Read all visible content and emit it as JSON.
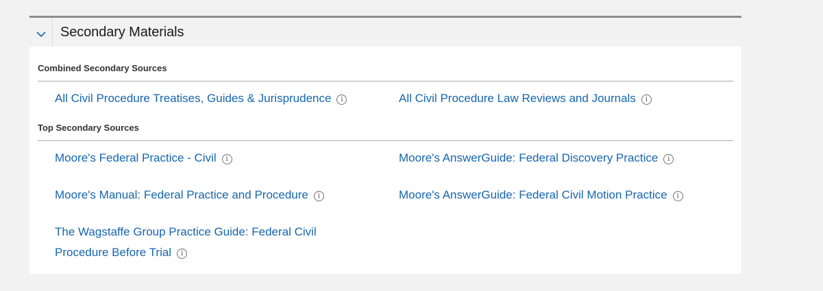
{
  "section": {
    "title": "Secondary Materials"
  },
  "groups": [
    {
      "label": "Combined Secondary Sources",
      "links": [
        {
          "text": "All Civil Procedure Treatises, Guides & Jurisprudence"
        },
        {
          "text": "All Civil Procedure Law Reviews and Journals"
        }
      ]
    },
    {
      "label": "Top Secondary Sources",
      "links": [
        {
          "text": "Moore's Federal Practice - Civil"
        },
        {
          "text": "Moore's AnswerGuide: Federal Discovery Practice"
        },
        {
          "text": "Moore's Manual: Federal Practice and Procedure"
        },
        {
          "text": "Moore's AnswerGuide: Federal Civil Motion Practice"
        },
        {
          "text": "The Wagstaffe Group Practice Guide: Federal Civil Procedure Before Trial"
        }
      ]
    }
  ],
  "icons": {
    "toggle": "chevron-down-icon",
    "info": "info-icon"
  },
  "colors": {
    "link": "#1565b0",
    "background": "#f2f2f2",
    "card": "#ffffff"
  }
}
